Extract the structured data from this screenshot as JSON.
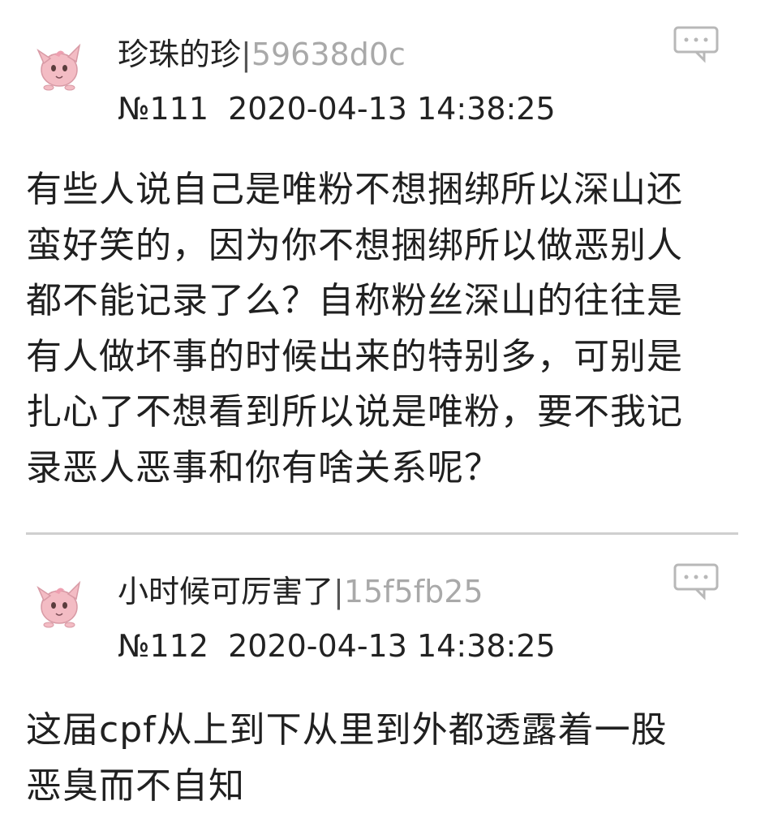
{
  "thread": {
    "posts": [
      {
        "author_name": "珍珠的珍",
        "separator": "|",
        "author_id": "59638d0c",
        "post_number": "№111",
        "timestamp": "2020-04-13 14:38:25",
        "content": "有些人说自己是唯粉不想捆绑所以深山还\n蛮好笑的，因为你不想捆绑所以做恶别人\n都不能记录了么？自称粉丝深山的往往是\n有人做坏事的时候出来的特别多，可别是\n扎心了不想看到所以说是唯粉，要不我记\n录恶人恶事和你有啥关系呢？"
      },
      {
        "author_name": "小时候可厉害了",
        "separator": "|",
        "author_id": "15f5fb25",
        "post_number": "№112",
        "timestamp": "2020-04-13 14:38:25",
        "content": "这届cpf从上到下从里到外都透露着一股\n恶臭而不自知"
      }
    ]
  },
  "icons": {
    "avatar": "pink-jigglypuff-avatar-icon",
    "reply": "speech-bubble-icon"
  },
  "colors": {
    "text": "#222222",
    "author_id": "#a9a9a9",
    "divider": "#cfcfcf",
    "icon_stroke": "#b8b8b8",
    "avatar_pink": "#f3bcc4"
  }
}
